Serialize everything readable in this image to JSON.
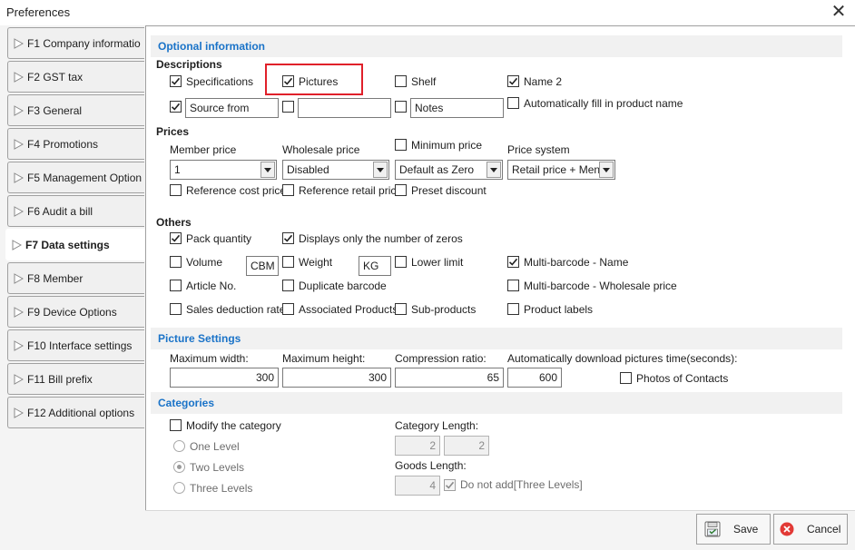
{
  "window": {
    "title": "Preferences",
    "close": "✕"
  },
  "nav": [
    {
      "label": "F1 Company informatio"
    },
    {
      "label": "F2 GST tax"
    },
    {
      "label": "F3 General"
    },
    {
      "label": "F4 Promotions"
    },
    {
      "label": "F5 Management Option"
    },
    {
      "label": "F6 Audit a bill"
    },
    {
      "label": "F7 Data settings",
      "active": true
    },
    {
      "label": "F8 Member"
    },
    {
      "label": "F9 Device Options"
    },
    {
      "label": "F10 Interface settings"
    },
    {
      "label": "F11 Bill prefix"
    },
    {
      "label": "F12 Additional options"
    }
  ],
  "optional": {
    "header": "Optional information",
    "descriptions": {
      "title": "Descriptions",
      "specifications": "Specifications",
      "pictures": "Pictures",
      "shelf": "Shelf",
      "name2": "Name 2",
      "source_from_value": "Source from",
      "blank_value": "",
      "notes_value": "Notes",
      "auto_fill": "Automatically fill in product name"
    },
    "prices": {
      "title": "Prices",
      "member_price_label": "Member price",
      "member_price_value": "1",
      "wholesale_price_label": "Wholesale price",
      "wholesale_price_value": "Disabled",
      "minimum_price_label": "Minimum price",
      "minimum_price_value": "Default as Zero",
      "price_system_label": "Price system",
      "price_system_value": "Retail price + Men",
      "reference_cost": "Reference cost price",
      "reference_retail": "Reference retail price",
      "preset_discount": "Preset discount"
    },
    "others": {
      "title": "Others",
      "pack_quantity": "Pack quantity",
      "zeros_only": "Displays only the number of zeros",
      "volume": "Volume",
      "volume_unit": "CBM",
      "weight": "Weight",
      "weight_unit": "KG",
      "lower_limit": "Lower limit",
      "multi_barcode_name": "Multi-barcode - Name",
      "article_no": "Article No.",
      "duplicate_barcode": "Duplicate barcode",
      "multi_barcode_wholesale": "Multi-barcode - Wholesale price",
      "sales_deduction": "Sales deduction rate",
      "associated_products": "Associated Products",
      "sub_products": "Sub-products",
      "product_labels": "Product labels"
    }
  },
  "picture": {
    "header": "Picture Settings",
    "max_width_label": "Maximum width:",
    "max_width_value": "300",
    "max_height_label": "Maximum height:",
    "max_height_value": "300",
    "compression_label": "Compression ratio:",
    "compression_value": "65",
    "auto_download_label": "Automatically download pictures time(seconds):",
    "auto_download_value": "600",
    "photos_of_contacts": "Photos of Contacts"
  },
  "categories": {
    "header": "Categories",
    "modify": "Modify the category",
    "one_level": "One Level",
    "two_levels": "Two Levels",
    "three_levels": "Three Levels",
    "category_length_label": "Category Length:",
    "category_length_1": "2",
    "category_length_2": "2",
    "goods_length_label": "Goods Length:",
    "goods_length_value": "4",
    "do_not_add": "Do not add[Three Levels]"
  },
  "footer": {
    "save": "Save",
    "cancel": "Cancel"
  },
  "colors": {
    "accent": "#1a73c8",
    "highlight": "#e0202a",
    "cancel_icon": "#e23a36"
  }
}
